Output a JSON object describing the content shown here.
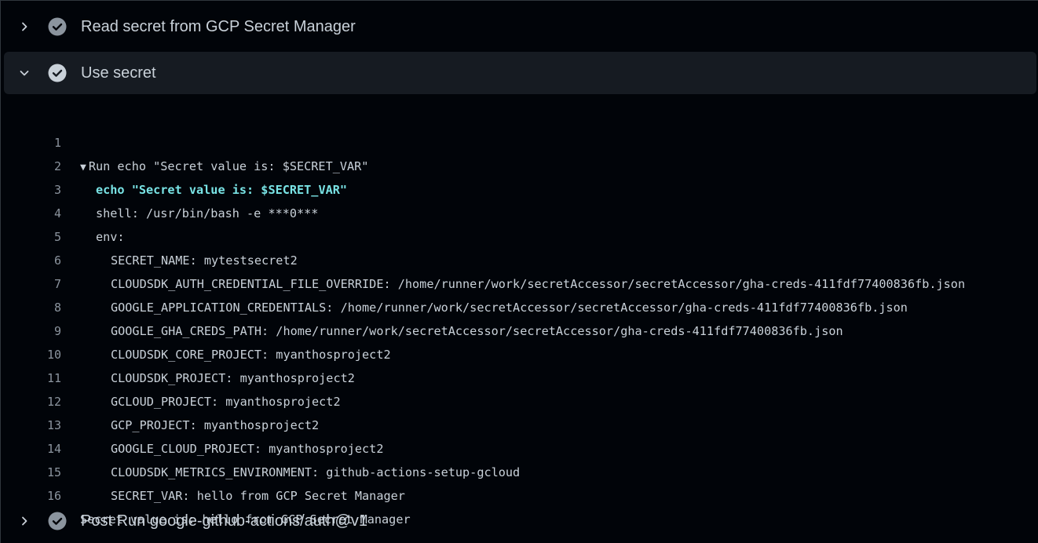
{
  "steps": [
    {
      "title": "Read secret from GCP Secret Manager",
      "state": "collapsed",
      "status": "success"
    },
    {
      "title": "Use secret",
      "state": "expanded",
      "status": "success"
    },
    {
      "title": "Post Run google-github-actions/auth@v1",
      "state": "collapsed",
      "status": "success"
    }
  ],
  "log": {
    "lines": [
      {
        "n": "1",
        "text": "Run echo \"Secret value is: $SECRET_VAR\""
      },
      {
        "n": "2",
        "text": "echo \"Secret value is: $SECRET_VAR\""
      },
      {
        "n": "3",
        "text": "shell: /usr/bin/bash -e ***0***"
      },
      {
        "n": "4",
        "text": "env:"
      },
      {
        "n": "5",
        "text": "SECRET_NAME: mytestsecret2"
      },
      {
        "n": "6",
        "text": "CLOUDSDK_AUTH_CREDENTIAL_FILE_OVERRIDE: /home/runner/work/secretAccessor/secretAccessor/gha-creds-411fdf77400836fb.json"
      },
      {
        "n": "7",
        "text": "GOOGLE_APPLICATION_CREDENTIALS: /home/runner/work/secretAccessor/secretAccessor/gha-creds-411fdf77400836fb.json"
      },
      {
        "n": "8",
        "text": "GOOGLE_GHA_CREDS_PATH: /home/runner/work/secretAccessor/secretAccessor/gha-creds-411fdf77400836fb.json"
      },
      {
        "n": "9",
        "text": "CLOUDSDK_CORE_PROJECT: myanthosproject2"
      },
      {
        "n": "10",
        "text": "CLOUDSDK_PROJECT: myanthosproject2"
      },
      {
        "n": "11",
        "text": "GCLOUD_PROJECT: myanthosproject2"
      },
      {
        "n": "12",
        "text": "GCP_PROJECT: myanthosproject2"
      },
      {
        "n": "13",
        "text": "GOOGLE_CLOUD_PROJECT: myanthosproject2"
      },
      {
        "n": "14",
        "text": "CLOUDSDK_METRICS_ENVIRONMENT: github-actions-setup-gcloud"
      },
      {
        "n": "15",
        "text": "SECRET_VAR: hello from GCP Secret Manager"
      },
      {
        "n": "16",
        "text": "Secret value is: hello from GCP Secret Manager"
      }
    ]
  },
  "icons": {
    "chevron_collapsed": "chevron-right-icon",
    "chevron_expanded": "chevron-down-icon",
    "status": "check-circle-icon",
    "group_toggle": "triangle-down-icon"
  },
  "colors": {
    "background": "#010409",
    "expanded_header": "#161b22",
    "text": "#c9d1d9",
    "line_number": "#8b949e",
    "command": "#79e3e5",
    "check_fill": "#8b949e"
  }
}
